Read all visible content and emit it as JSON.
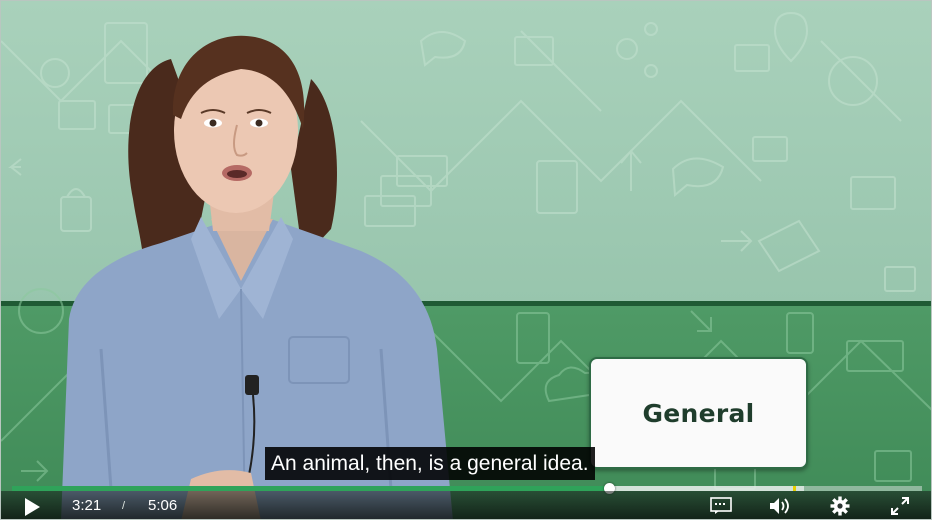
{
  "player": {
    "card_label": "General",
    "subtitle": "An animal, then, is a general idea.",
    "time_current": "3:21",
    "time_separator": "/",
    "time_total": "5:06",
    "progress_fraction": 0.656,
    "buffered_fraction": 0.87
  },
  "icons": {
    "play": "play-icon",
    "captions": "captions-icon",
    "volume": "volume-icon",
    "settings": "gear-icon",
    "fullscreen": "fullscreen-icon"
  },
  "colors": {
    "upper_background": "#a9d1bb",
    "lower_background": "#4f9a66",
    "progress_fill": "#2fa35a",
    "chapter_marker": "#e6d000",
    "card_text": "#1f3d2c"
  }
}
